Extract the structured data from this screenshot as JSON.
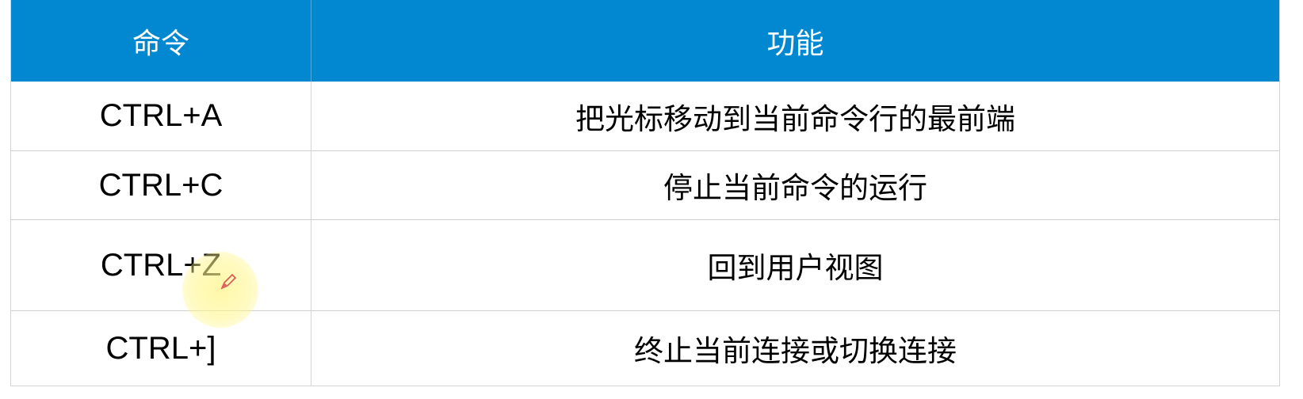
{
  "table": {
    "header": {
      "col1": "命令",
      "col2": "功能"
    },
    "rows": [
      {
        "command": "CTRL+A",
        "function": "把光标移动到当前命令行的最前端"
      },
      {
        "command": "CTRL+C",
        "function": "停止当前命令的运行"
      },
      {
        "command": "CTRL+Z",
        "function": "回到用户视图"
      },
      {
        "command": "CTRL+]",
        "function": "终止当前连接或切换连接"
      }
    ]
  },
  "colors": {
    "header_bg": "#0288d1",
    "header_text": "#ffffff",
    "body_text": "#000000",
    "cursor_highlight": "#fff68c"
  },
  "icons": {
    "cursor": "pen-cursor-icon"
  }
}
